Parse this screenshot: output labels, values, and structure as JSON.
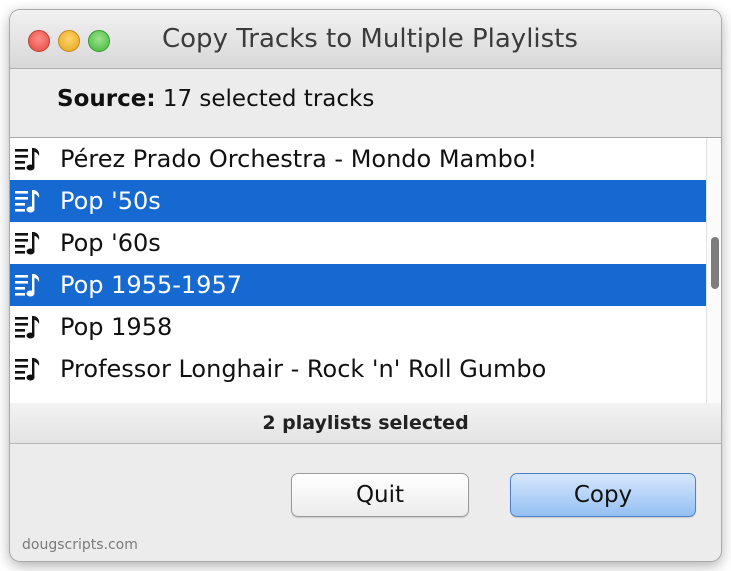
{
  "window": {
    "title": "Copy Tracks to Multiple Playlists"
  },
  "source": {
    "label": "Source:",
    "value": "17 selected tracks"
  },
  "playlists": [
    {
      "name": "Pérez Prado Orchestra - Mondo Mambo!",
      "selected": false,
      "icon": "playlist-icon"
    },
    {
      "name": "Pop '50s",
      "selected": true,
      "icon": "playlist-icon"
    },
    {
      "name": "Pop '60s",
      "selected": false,
      "icon": "playlist-icon"
    },
    {
      "name": "Pop 1955-1957",
      "selected": true,
      "icon": "playlist-icon"
    },
    {
      "name": "Pop 1958",
      "selected": false,
      "icon": "playlist-icon"
    },
    {
      "name": "Professor Longhair - Rock 'n' Roll Gumbo",
      "selected": false,
      "icon": "playlist-icon"
    }
  ],
  "status": {
    "text": "2 playlists selected"
  },
  "buttons": {
    "quit": "Quit",
    "copy": "Copy"
  },
  "footer": {
    "text": "dougscripts.com"
  },
  "colors": {
    "selection": "#1769d2",
    "default_button": "#94c0f3",
    "window_bg": "#ececec"
  }
}
